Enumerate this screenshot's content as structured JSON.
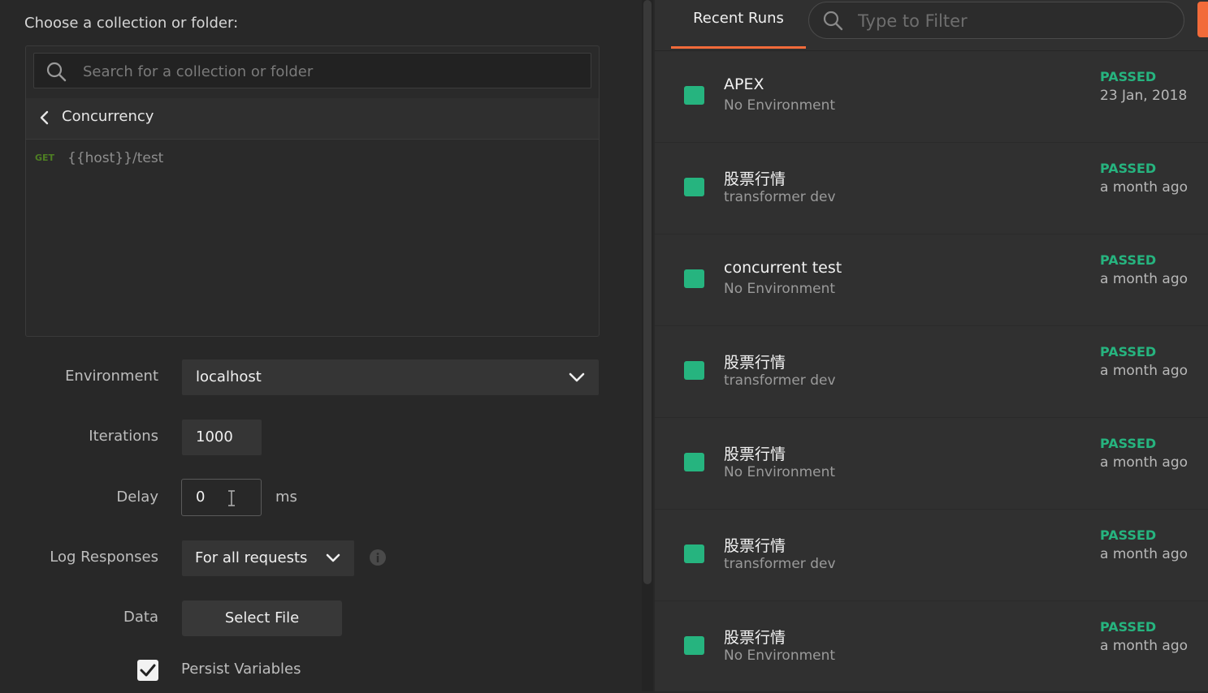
{
  "runner": {
    "choose_label": "Choose a collection or folder:",
    "search_placeholder": "Search for a collection or folder",
    "breadcrumb": "Concurrency",
    "requests": [
      {
        "method": "GET",
        "url": "{{host}}/test"
      }
    ]
  },
  "form": {
    "environment_label": "Environment",
    "environment_value": "localhost",
    "iterations_label": "Iterations",
    "iterations_value": "1000",
    "delay_label": "Delay",
    "delay_value": "0",
    "delay_unit": "ms",
    "log_label": "Log Responses",
    "log_value": "For all requests",
    "data_label": "Data",
    "data_button": "Select File",
    "persist_label": "Persist Variables",
    "persist_checked": true
  },
  "recent": {
    "tab_label": "Recent Runs",
    "filter_placeholder": "Type to Filter",
    "status_color": "#26b47f",
    "runs": [
      {
        "name": "APEX",
        "environment": "No Environment",
        "status": "PASSED",
        "when": "23 Jan, 2018"
      },
      {
        "name": "股票行情",
        "environment": "transformer dev",
        "status": "PASSED",
        "when": "a month ago"
      },
      {
        "name": "concurrent test",
        "environment": "No Environment",
        "status": "PASSED",
        "when": "a month ago"
      },
      {
        "name": "股票行情",
        "environment": "transformer dev",
        "status": "PASSED",
        "when": "a month ago"
      },
      {
        "name": "股票行情",
        "environment": "No Environment",
        "status": "PASSED",
        "when": "a month ago"
      },
      {
        "name": "股票行情",
        "environment": "transformer dev",
        "status": "PASSED",
        "when": "a month ago"
      },
      {
        "name": "股票行情",
        "environment": "No Environment",
        "status": "PASSED",
        "when": "a month ago"
      }
    ]
  }
}
